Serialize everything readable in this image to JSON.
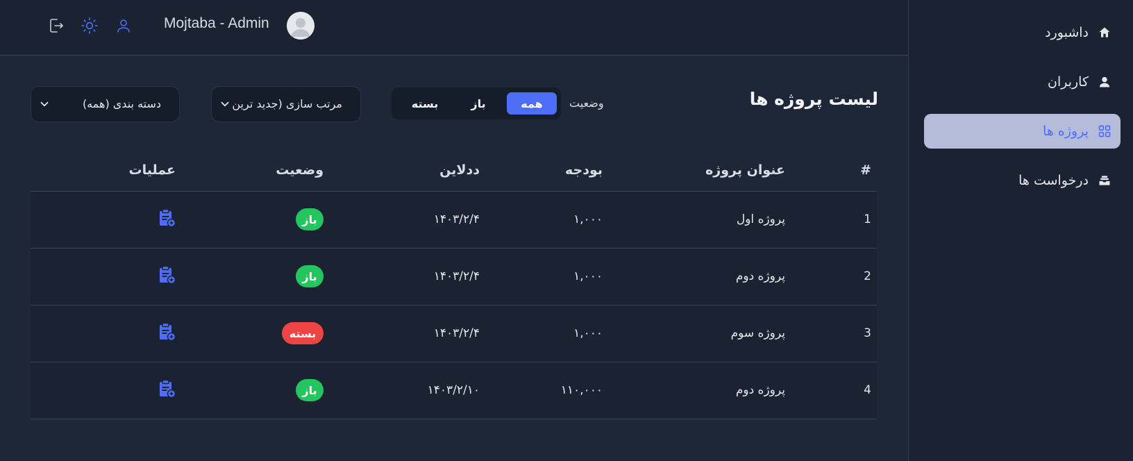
{
  "colors": {
    "accent": "#4f6ef7",
    "open": "#22c55e",
    "closed": "#ef4444",
    "active_nav_bg": "#b4bcda"
  },
  "header": {
    "user_name": "Mojtaba - Admin",
    "icons": [
      "logout-icon",
      "sun-icon",
      "user-icon"
    ]
  },
  "sidebar": {
    "items": [
      {
        "label": "داشبورد",
        "icon": "home-icon",
        "active": false
      },
      {
        "label": "کاربران",
        "icon": "user-icon",
        "active": false
      },
      {
        "label": "پروژه ها",
        "icon": "grid-icon",
        "active": true
      },
      {
        "label": "درخواست ها",
        "icon": "inbox-icon",
        "active": false
      }
    ]
  },
  "toolbar": {
    "title": "لیست پروژه ها",
    "status_label": "وضعیت",
    "status_options": [
      "همه",
      "باز",
      "بسته"
    ],
    "status_selected": "همه",
    "sort_select": "مرتب سازی (جدید ترین)",
    "category_select": "دسته بندی (همه)"
  },
  "table": {
    "headers": {
      "index": "#",
      "title": "عنوان پروژه",
      "budget": "بودجه",
      "deadline": "ددلاین",
      "status": "وضعیت",
      "actions": "عملیات"
    },
    "rows": [
      {
        "index": "1",
        "title": "پروژه اول",
        "budget": "۱,۰۰۰",
        "deadline": "۱۴۰۳/۲/۴",
        "status": "باز",
        "status_type": "open"
      },
      {
        "index": "2",
        "title": "پروژه دوم",
        "budget": "۱,۰۰۰",
        "deadline": "۱۴۰۳/۲/۴",
        "status": "باز",
        "status_type": "open"
      },
      {
        "index": "3",
        "title": "پروژه سوم",
        "budget": "۱,۰۰۰",
        "deadline": "۱۴۰۳/۲/۴",
        "status": "بسته",
        "status_type": "closed"
      },
      {
        "index": "4",
        "title": "پروژه دوم",
        "budget": "۱۱۰,۰۰۰",
        "deadline": "۱۴۰۳/۲/۱۰",
        "status": "باز",
        "status_type": "open"
      }
    ]
  }
}
